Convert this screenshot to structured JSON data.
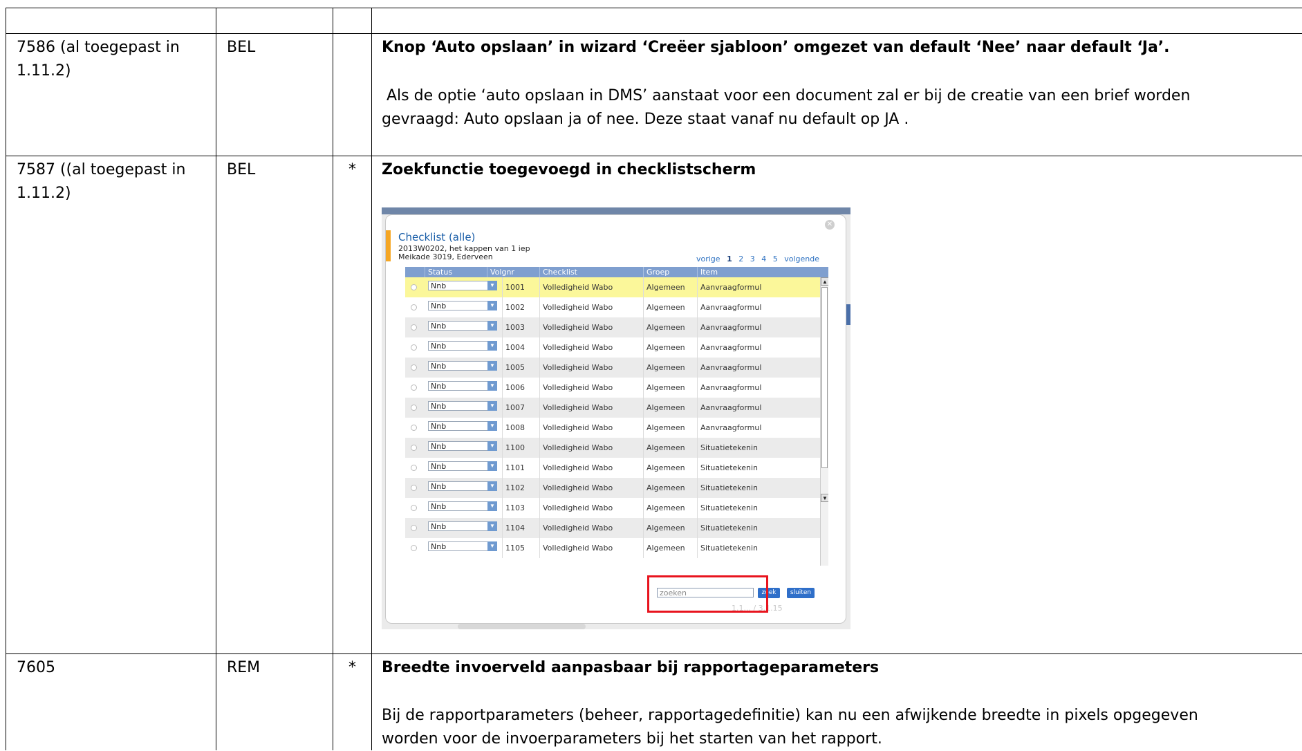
{
  "rows": [
    {
      "id": "7586 (al toegepast in 1.11.2)",
      "id_line1": "7586 (al toegepast in",
      "id_line2": "1.11.2)",
      "module": "BEL",
      "star": "",
      "title": "Knop ‘Auto opslaan’  in wizard ‘Creëer sjabloon’ omgezet van default ‘Nee’ naar default ‘Ja’.",
      "body_line1": " Als de optie ‘auto opslaan in DMS’ aanstaat voor een document zal er bij de creatie van een brief worden",
      "body_line2": "gevraagd: Auto opslaan ja of nee. Deze staat vanaf nu default op JA ."
    },
    {
      "id_line1": "7587 ((al toegepast in",
      "id_line2": "1.11.2)",
      "module": "BEL",
      "star": "*",
      "title": "Zoekfunctie toegevoegd in checklistscherm"
    },
    {
      "id_line1": "7605",
      "module": "REM",
      "star": "*",
      "title": "Breedte invoerveld aanpasbaar bij rapportageparameters",
      "body_line1": "Bij de rapportparameters (beheer, rapportagedefinitie) kan nu een afwijkende breedte in pixels opgegeven",
      "body_line2": "worden voor de invoerparameters bij het starten van het rapport."
    }
  ],
  "checklist": {
    "title": "Checklist (alle)",
    "subtitle1": "2013W0202, het kappen van 1 iep",
    "subtitle2": "Meikade 3019, Ederveen",
    "pager": {
      "prev": "vorige",
      "pages": [
        "1",
        "2",
        "3",
        "4",
        "5"
      ],
      "current": "1",
      "next": "volgende"
    },
    "columns": [
      "Status",
      "Volgnr",
      "Checklist",
      "Groep",
      "Item"
    ],
    "rows": [
      {
        "status": "Nnb",
        "volgnr": "1001",
        "checklist": "Volledigheid Wabo",
        "groep": "Algemeen",
        "item": "Aanvraagformul"
      },
      {
        "status": "Nnb",
        "volgnr": "1002",
        "checklist": "Volledigheid Wabo",
        "groep": "Algemeen",
        "item": "Aanvraagformul"
      },
      {
        "status": "Nnb",
        "volgnr": "1003",
        "checklist": "Volledigheid Wabo",
        "groep": "Algemeen",
        "item": "Aanvraagformul"
      },
      {
        "status": "Nnb",
        "volgnr": "1004",
        "checklist": "Volledigheid Wabo",
        "groep": "Algemeen",
        "item": "Aanvraagformul"
      },
      {
        "status": "Nnb",
        "volgnr": "1005",
        "checklist": "Volledigheid Wabo",
        "groep": "Algemeen",
        "item": "Aanvraagformul"
      },
      {
        "status": "Nnb",
        "volgnr": "1006",
        "checklist": "Volledigheid Wabo",
        "groep": "Algemeen",
        "item": "Aanvraagformul"
      },
      {
        "status": "Nnb",
        "volgnr": "1007",
        "checklist": "Volledigheid Wabo",
        "groep": "Algemeen",
        "item": "Aanvraagformul"
      },
      {
        "status": "Nnb",
        "volgnr": "1008",
        "checklist": "Volledigheid Wabo",
        "groep": "Algemeen",
        "item": "Aanvraagformul"
      },
      {
        "status": "Nnb",
        "volgnr": "1100",
        "checklist": "Volledigheid Wabo",
        "groep": "Algemeen",
        "item": "Situatietekenin"
      },
      {
        "status": "Nnb",
        "volgnr": "1101",
        "checklist": "Volledigheid Wabo",
        "groep": "Algemeen",
        "item": "Situatietekenin"
      },
      {
        "status": "Nnb",
        "volgnr": "1102",
        "checklist": "Volledigheid Wabo",
        "groep": "Algemeen",
        "item": "Situatietekenin"
      },
      {
        "status": "Nnb",
        "volgnr": "1103",
        "checklist": "Volledigheid Wabo",
        "groep": "Algemeen",
        "item": "Situatietekenin"
      },
      {
        "status": "Nnb",
        "volgnr": "1104",
        "checklist": "Volledigheid Wabo",
        "groep": "Algemeen",
        "item": "Situatietekenin"
      },
      {
        "status": "Nnb",
        "volgnr": "1105",
        "checklist": "Volledigheid Wabo",
        "groep": "Algemeen",
        "item": "Situatietekenin"
      }
    ],
    "search_placeholder": "zoeken",
    "search_button": "zoek",
    "close_button": "sluiten",
    "version": "1.1... / 3.1.15",
    "colors": {
      "header": "#7f9fcf",
      "selected_row": "#fbf79a",
      "alt_row": "#ebebeb",
      "highlight_box": "#e8141e",
      "accent": "#f5a623"
    }
  }
}
